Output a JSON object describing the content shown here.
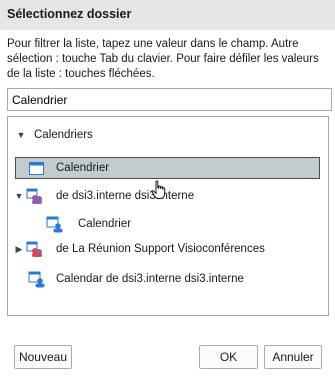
{
  "dialog": {
    "title": "Sélectionnez dossier",
    "instructions": "Pour filtrer la liste, tapez une valeur dans le champ. Autre sélection : touche Tab du clavier. Pour faire défiler les valeurs de la liste : touches fléchées."
  },
  "search": {
    "value": "Calendrier"
  },
  "tree": {
    "root": {
      "label": "Calendriers",
      "expanded": true
    },
    "items": [
      {
        "label": "Calendrier",
        "icon": "calendar-icon",
        "selected": true
      },
      {
        "label": "de dsi3.interne dsi3.interne",
        "icon": "shared-group-calendar-icon",
        "expanded": true
      },
      {
        "label": "Calendrier",
        "icon": "user-calendar-icon"
      },
      {
        "label": "de La Réunion Support Visioconférences",
        "icon": "shared-group-calendar-icon",
        "expanded": false
      },
      {
        "label": "Calendar de dsi3.interne dsi3.interne",
        "icon": "user-calendar-icon"
      }
    ]
  },
  "buttons": {
    "new": "Nouveau",
    "ok": "OK",
    "cancel": "Annuler"
  },
  "colors": {
    "selection": "#c3cbcf",
    "title_bar": "#e6e6e6",
    "accent_blue": "#2b79d0",
    "shared_red": "#d84a4a",
    "shared_purple": "#8a5fb0"
  }
}
